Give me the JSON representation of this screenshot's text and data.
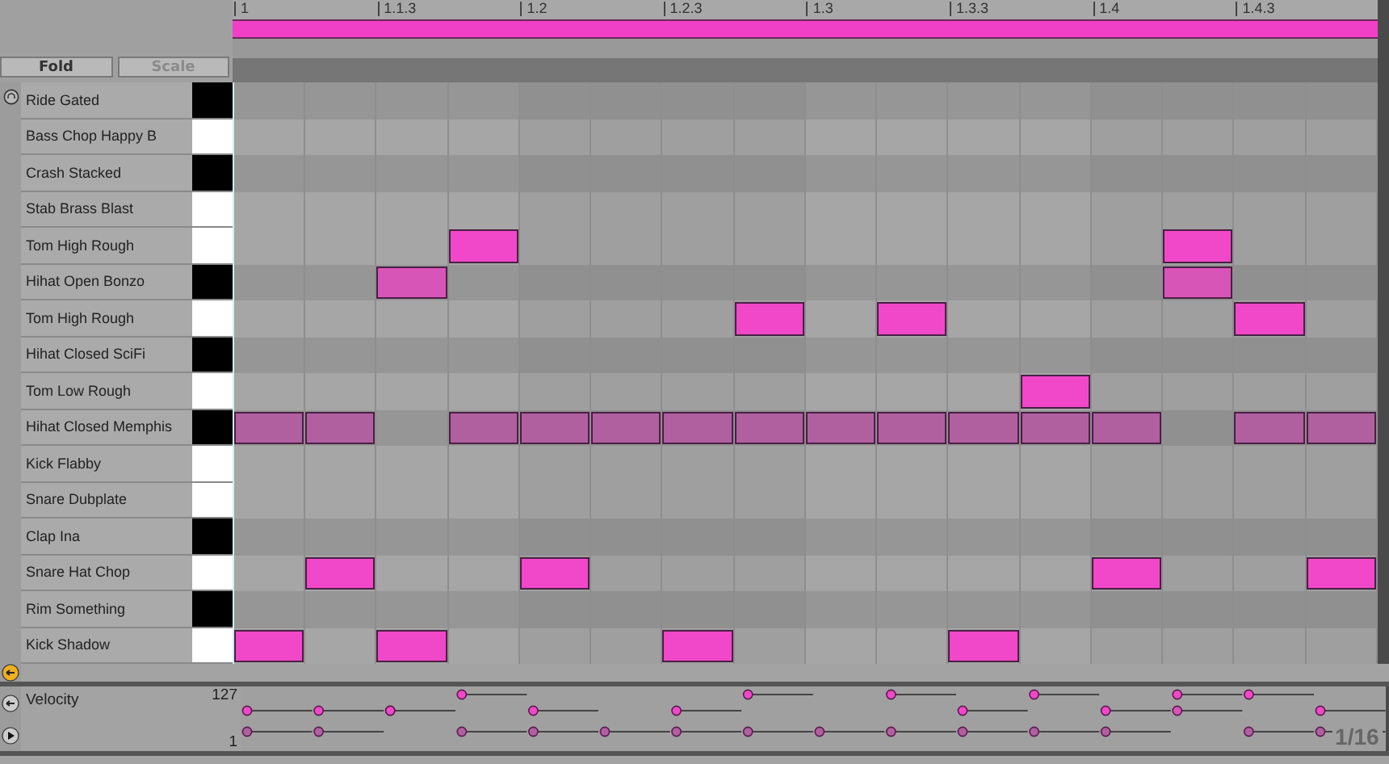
{
  "ruler": [
    "1",
    "1.1.3",
    "1.2",
    "1.2.3",
    "1.3",
    "1.3.3",
    "1.4",
    "1.4.3"
  ],
  "buttons": [
    {
      "label": "Fold",
      "disabled": false
    },
    {
      "label": "Scale",
      "disabled": true
    }
  ],
  "rows": [
    {
      "name": "Ride Gated",
      "kind": "black",
      "steps": [
        false,
        false,
        false,
        false,
        false,
        false,
        false,
        false,
        false,
        false,
        false,
        false,
        false,
        false,
        false,
        false
      ]
    },
    {
      "name": "Bass Chop Happy B",
      "kind": "white",
      "steps": [
        false,
        false,
        false,
        false,
        false,
        false,
        false,
        false,
        false,
        false,
        false,
        false,
        false,
        false,
        false,
        false
      ]
    },
    {
      "name": "Crash Stacked",
      "kind": "black",
      "steps": [
        false,
        false,
        false,
        false,
        false,
        false,
        false,
        false,
        false,
        false,
        false,
        false,
        false,
        false,
        false,
        false
      ]
    },
    {
      "name": "Stab Brass Blast",
      "kind": "white",
      "steps": [
        false,
        false,
        false,
        false,
        false,
        false,
        false,
        false,
        false,
        false,
        false,
        false,
        false,
        false,
        false,
        false
      ]
    },
    {
      "name": "Tom High Rough",
      "kind": "white",
      "color": "#f048c8",
      "steps": [
        false,
        false,
        false,
        true,
        false,
        false,
        false,
        false,
        false,
        false,
        false,
        false,
        false,
        true,
        false,
        false
      ]
    },
    {
      "name": "Hihat Open Bonzo",
      "kind": "black",
      "color": "#d855b8",
      "steps": [
        false,
        false,
        true,
        false,
        false,
        false,
        false,
        false,
        false,
        false,
        false,
        false,
        false,
        true,
        false,
        false
      ]
    },
    {
      "name": "Tom High Rough",
      "kind": "white",
      "color": "#f048c8",
      "steps": [
        false,
        false,
        false,
        false,
        false,
        false,
        false,
        true,
        false,
        true,
        false,
        false,
        false,
        false,
        true,
        false
      ]
    },
    {
      "name": "Hihat Closed SciFi",
      "kind": "black",
      "steps": [
        false,
        false,
        false,
        false,
        false,
        false,
        false,
        false,
        false,
        false,
        false,
        false,
        false,
        false,
        false,
        false
      ]
    },
    {
      "name": "Tom Low Rough",
      "kind": "white",
      "color": "#f048c8",
      "steps": [
        false,
        false,
        false,
        false,
        false,
        false,
        false,
        false,
        false,
        false,
        false,
        true,
        false,
        false,
        false,
        false
      ]
    },
    {
      "name": "Hihat Closed Memphis",
      "kind": "black",
      "color": "#b0609f",
      "steps": [
        true,
        true,
        false,
        true,
        true,
        true,
        true,
        true,
        true,
        true,
        true,
        true,
        true,
        false,
        true,
        true
      ]
    },
    {
      "name": "Kick Flabby",
      "kind": "white",
      "steps": [
        false,
        false,
        false,
        false,
        false,
        false,
        false,
        false,
        false,
        false,
        false,
        false,
        false,
        false,
        false,
        false
      ]
    },
    {
      "name": "Snare Dubplate",
      "kind": "white",
      "steps": [
        false,
        false,
        false,
        false,
        false,
        false,
        false,
        false,
        false,
        false,
        false,
        false,
        false,
        false,
        false,
        false
      ]
    },
    {
      "name": "Clap Ina",
      "kind": "black",
      "steps": [
        false,
        false,
        false,
        false,
        false,
        false,
        false,
        false,
        false,
        false,
        false,
        false,
        false,
        false,
        false,
        false
      ]
    },
    {
      "name": "Snare Hat Chop",
      "kind": "white",
      "color": "#f048c8",
      "steps": [
        false,
        true,
        false,
        false,
        true,
        false,
        false,
        false,
        false,
        false,
        false,
        false,
        true,
        false,
        false,
        true
      ]
    },
    {
      "name": "Rim Something",
      "kind": "black",
      "steps": [
        false,
        false,
        false,
        false,
        false,
        false,
        false,
        false,
        false,
        false,
        false,
        false,
        false,
        false,
        false,
        false
      ]
    },
    {
      "name": "Kick Shadow",
      "kind": "white",
      "color": "#f048c8",
      "steps": [
        true,
        false,
        true,
        false,
        false,
        false,
        true,
        false,
        false,
        false,
        true,
        false,
        false,
        false,
        false,
        false
      ]
    }
  ],
  "velocity": {
    "label": "Velocity",
    "max": "127",
    "min": "1"
  },
  "grid_label": "1/16"
}
